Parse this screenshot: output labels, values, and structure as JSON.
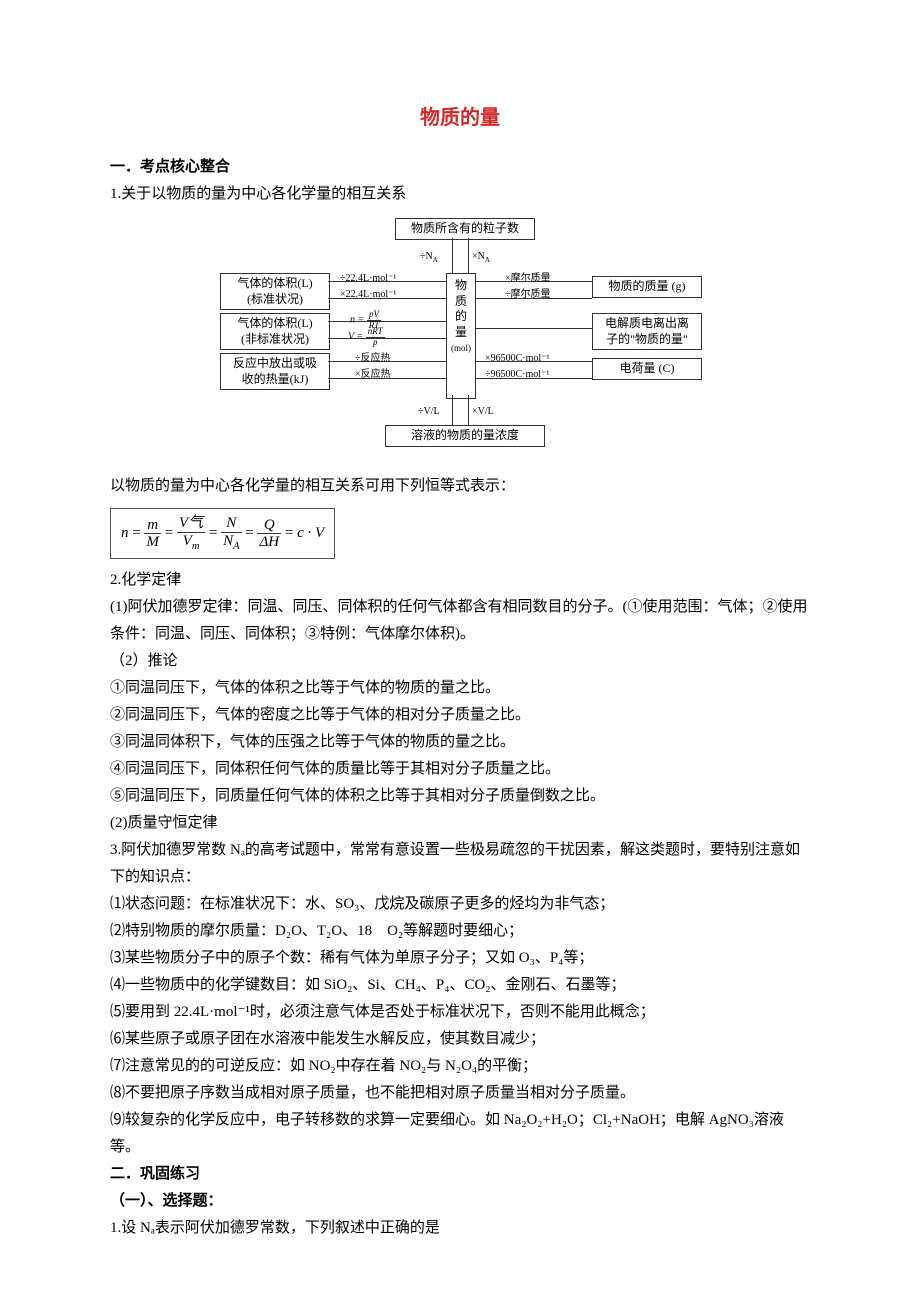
{
  "title": "物质的量",
  "s1_heading": "一．考点核心整合",
  "s1_1": "1.关于以物质的量为中心各化学量的相互关系",
  "diagram": {
    "top": "物质所含有的粒子数",
    "top_l": "÷N",
    "top_r": "×N",
    "left1": "气体的体积(L)\n(标准状况)",
    "left1_t": "÷22.4L·mol⁻¹",
    "left1_b": "×22.4L·mol⁻¹",
    "left2": "气体的体积(L)\n(非标准状况)",
    "left2_t": "n = pV/RT",
    "left2_b": "V = nRT/p",
    "left3": "反应中放出或吸\n收的热量(kJ)",
    "left3_t": "÷反应热",
    "left3_b": "×反应热",
    "right1": "物质的质量 (g)",
    "right1_t": "×摩尔质量",
    "right1_b": "÷摩尔质量",
    "right2": "电解质电离出离\n子的\"物质的量\"",
    "right3": "电荷量 (C)",
    "right3_t": "×96500C·mol⁻¹",
    "right3_b": "÷96500C·mol⁻¹",
    "center": "物\n质\n的\n量\n(mol)",
    "bottom": "溶液的物质的量浓度",
    "bottom_l": "÷V/L",
    "bottom_r": "×V/L"
  },
  "s1_after_diagram": "以物质的量为中心各化学量的相互关系可用下列恒等式表示：",
  "formula": {
    "n": "n",
    "eq": "=",
    "m": "m",
    "M": "M",
    "Vq": "V气",
    "Vm": "Vₘ",
    "N": "N",
    "NA": "N",
    "Q": "Q",
    "dH": "ΔH",
    "cV": "c · V"
  },
  "s1_2": "2.化学定律",
  "s1_2_1": "(1)阿伏加德罗定律：同温、同压、同体积的任何气体都含有相同数目的分子。(①使用范围：气体；②使用条件：同温、同压、同体积；③特例：气体摩尔体积)。",
  "s1_2_2h": "（2）推论",
  "s1_2_2a": "①同温同压下，气体的体积之比等于气体的物质的量之比。",
  "s1_2_2b": "②同温同压下，气体的密度之比等于气体的相对分子质量之比。",
  "s1_2_2c": "③同温同体积下，气体的压强之比等于气体的物质的量之比。",
  "s1_2_2d": "④同温同压下，同体积任何气体的质量比等于其相对分子质量之比。",
  "s1_2_2e": "⑤同温同压下，同质量任何气体的体积之比等于其相对分子质量倒数之比。",
  "s1_2_3": "(2)质量守恒定律",
  "s1_3": "3.阿伏加德罗常数 Nₐ的高考试题中，常常有意设置一些极易疏忽的干扰因素，解这类题时，要特别注意如下的知识点：",
  "s1_3_1": "⑴状态问题：在标准状况下：水、SO₃、戊烷及碳原子更多的烃均为非气态；",
  "s1_3_2": "⑵特别物质的摩尔质量：D₂O、T₂O、18　O₂等解题时要细心；",
  "s1_3_3": "⑶某些物质分子中的原子个数：稀有气体为单原子分子；又如 O₃、P₄等；",
  "s1_3_4": "⑷一些物质中的化学键数目：如 SiO₂、Si、CH₄、P₄、CO₂、金刚石、石墨等；",
  "s1_3_5": "⑸要用到 22.4L·mol⁻¹时，必须注意气体是否处于标准状况下，否则不能用此概念；",
  "s1_3_6": "⑹某些原子或原子团在水溶液中能发生水解反应，使其数目减少；",
  "s1_3_7": "⑺注意常见的的可逆反应：如 NO₂中存在着 NO₂与 N₂O₄的平衡；",
  "s1_3_8": "⑻不要把原子序数当成相对原子质量，也不能把相对原子质量当相对分子质量。",
  "s1_3_9": "⑼较复杂的化学反应中，电子转移数的求算一定要细心。如 Na₂O₂+H₂O；Cl₂+NaOH；电解 AgNO₃溶液等。",
  "s2_heading": "二．巩固练习",
  "s2_sub": "（一）、选择题：",
  "q1": "1.设 Nₐ表示阿伏加德罗常数，下列叙述中正确的是"
}
